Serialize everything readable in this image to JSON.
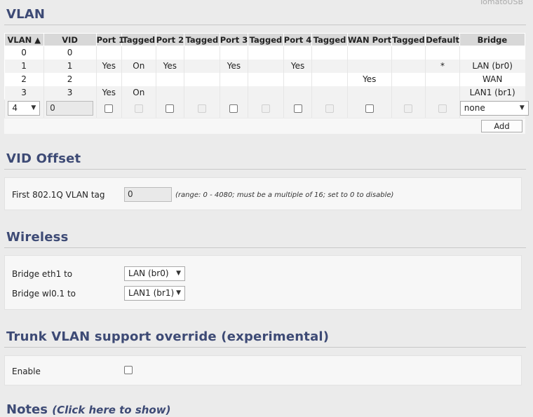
{
  "brand": "TomatoUSB",
  "vlan": {
    "title": "VLAN",
    "headers": [
      "VLAN ▲",
      "VID",
      "Port 1",
      "Tagged",
      "Port 2",
      "Tagged",
      "Port 3",
      "Tagged",
      "Port 4",
      "Tagged",
      "WAN Port",
      "Tagged",
      "Default",
      "Bridge"
    ],
    "rows": [
      [
        "0",
        "0",
        "",
        "",
        "",
        "",
        "",
        "",
        "",
        "",
        "",
        "",
        "",
        ""
      ],
      [
        "1",
        "1",
        "Yes",
        "On",
        "Yes",
        "",
        "Yes",
        "",
        "Yes",
        "",
        "",
        "",
        "*",
        "LAN (br0)"
      ],
      [
        "2",
        "2",
        "",
        "",
        "",
        "",
        "",
        "",
        "",
        "",
        "Yes",
        "",
        "",
        "WAN"
      ],
      [
        "3",
        "3",
        "Yes",
        "On",
        "",
        "",
        "",
        "",
        "",
        "",
        "",
        "",
        "",
        "LAN1 (br1)"
      ]
    ],
    "new_row": {
      "vlan_select": "4",
      "vid_value": "0",
      "bridge_select": "none"
    },
    "add_label": "Add"
  },
  "vid_offset": {
    "title": "VID Offset",
    "label": "First 802.1Q VLAN tag",
    "value": "0",
    "hint": "(range: 0 - 4080; must be a multiple of 16; set to 0 to disable)"
  },
  "wireless": {
    "title": "Wireless",
    "items": [
      {
        "label": "Bridge eth1 to",
        "value": "LAN (br0)"
      },
      {
        "label": "Bridge wl0.1 to",
        "value": "LAN1 (br1)"
      }
    ]
  },
  "trunk": {
    "title": "Trunk VLAN support override (experimental)",
    "enable_label": "Enable"
  },
  "notes": {
    "title": "Notes",
    "toggle": "(Click here to show)"
  }
}
